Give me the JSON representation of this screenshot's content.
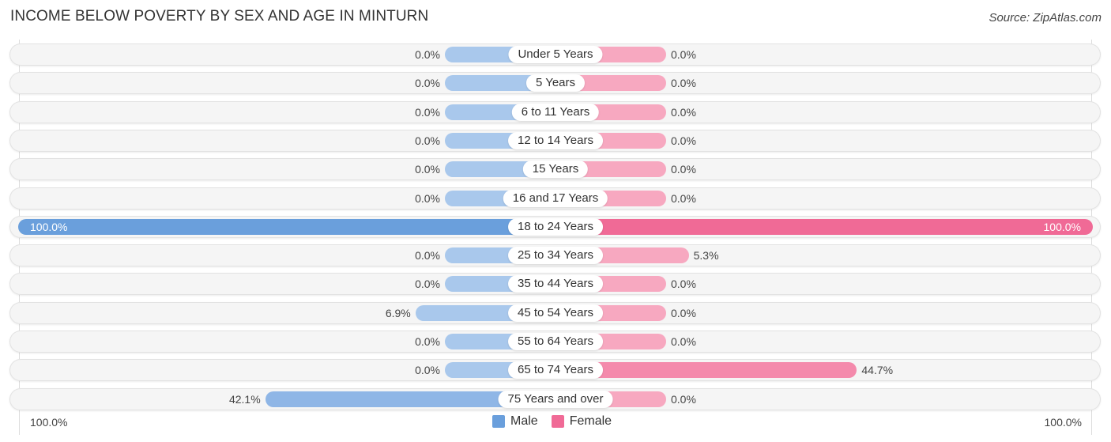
{
  "chart_data": {
    "type": "bar",
    "orientation": "horizontal-diverging",
    "title": "INCOME BELOW POVERTY BY SEX AND AGE IN MINTURN",
    "source": "Source: ZipAtlas.com",
    "categories": [
      "Under 5 Years",
      "5 Years",
      "6 to 11 Years",
      "12 to 14 Years",
      "15 Years",
      "16 and 17 Years",
      "18 to 24 Years",
      "25 to 34 Years",
      "35 to 44 Years",
      "45 to 54 Years",
      "55 to 64 Years",
      "65 to 74 Years",
      "75 Years and over"
    ],
    "series": [
      {
        "name": "Male",
        "color": "#6a9fdc",
        "values": [
          0.0,
          0.0,
          0.0,
          0.0,
          0.0,
          0.0,
          100.0,
          0.0,
          0.0,
          6.9,
          0.0,
          0.0,
          42.1
        ],
        "labels": [
          "0.0%",
          "0.0%",
          "0.0%",
          "0.0%",
          "0.0%",
          "0.0%",
          "100.0%",
          "0.0%",
          "0.0%",
          "6.9%",
          "0.0%",
          "0.0%",
          "42.1%"
        ]
      },
      {
        "name": "Female",
        "color": "#f06a96",
        "values": [
          0.0,
          0.0,
          0.0,
          0.0,
          0.0,
          0.0,
          100.0,
          5.3,
          0.0,
          0.0,
          0.0,
          44.7,
          0.0
        ],
        "labels": [
          "0.0%",
          "0.0%",
          "0.0%",
          "0.0%",
          "0.0%",
          "0.0%",
          "100.0%",
          "5.3%",
          "0.0%",
          "0.0%",
          "0.0%",
          "44.7%",
          "0.0%"
        ]
      }
    ],
    "xlim": [
      -100,
      100
    ],
    "axis_labels": {
      "left": "100.0%",
      "right": "100.0%"
    },
    "legend": {
      "position": "bottom-center",
      "entries": [
        "Male",
        "Female"
      ]
    },
    "grid": false
  }
}
